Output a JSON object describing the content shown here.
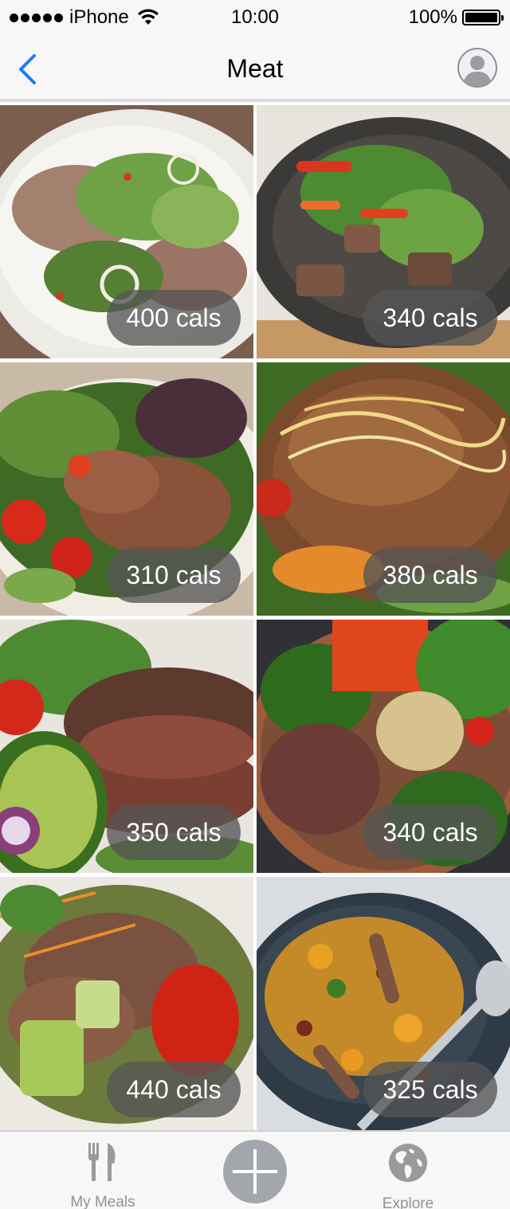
{
  "status_bar": {
    "carrier": "iPhone",
    "time": "10:00",
    "battery_percent": "100%",
    "battery_level": 1.0,
    "signal_bars": 5
  },
  "nav": {
    "title": "Meat",
    "back_icon": "chevron-left-icon",
    "profile_icon": "avatar-icon",
    "accent_color": "#1a7cf6"
  },
  "meals": [
    {
      "calories": "400 cals",
      "photo": "steak salad with greens and onion on white plate"
    },
    {
      "calories": "340 cals",
      "photo": "beef salad with peppers and herbs on dark plate"
    },
    {
      "calories": "310 cals",
      "photo": "sliced steak salad with tomatoes"
    },
    {
      "calories": "380 cals",
      "photo": "ground beef taco salad with cheese"
    },
    {
      "calories": "350 cals",
      "photo": "grilled steak with avocado and greens"
    },
    {
      "calories": "340 cals",
      "photo": "beef bowl with vegetables and nuts"
    },
    {
      "calories": "440 cals",
      "photo": "beef salad with cucumber and tomato"
    },
    {
      "calories": "325 cals",
      "photo": "steak with squash, corn and beans in skillet"
    }
  ],
  "tab_bar": {
    "my_meals_label": "My Meals",
    "explore_label": "Explore",
    "my_meals_icon": "fork-knife-icon",
    "add_icon": "plus-icon",
    "explore_icon": "globe-icon",
    "inactive_color": "#929292"
  }
}
